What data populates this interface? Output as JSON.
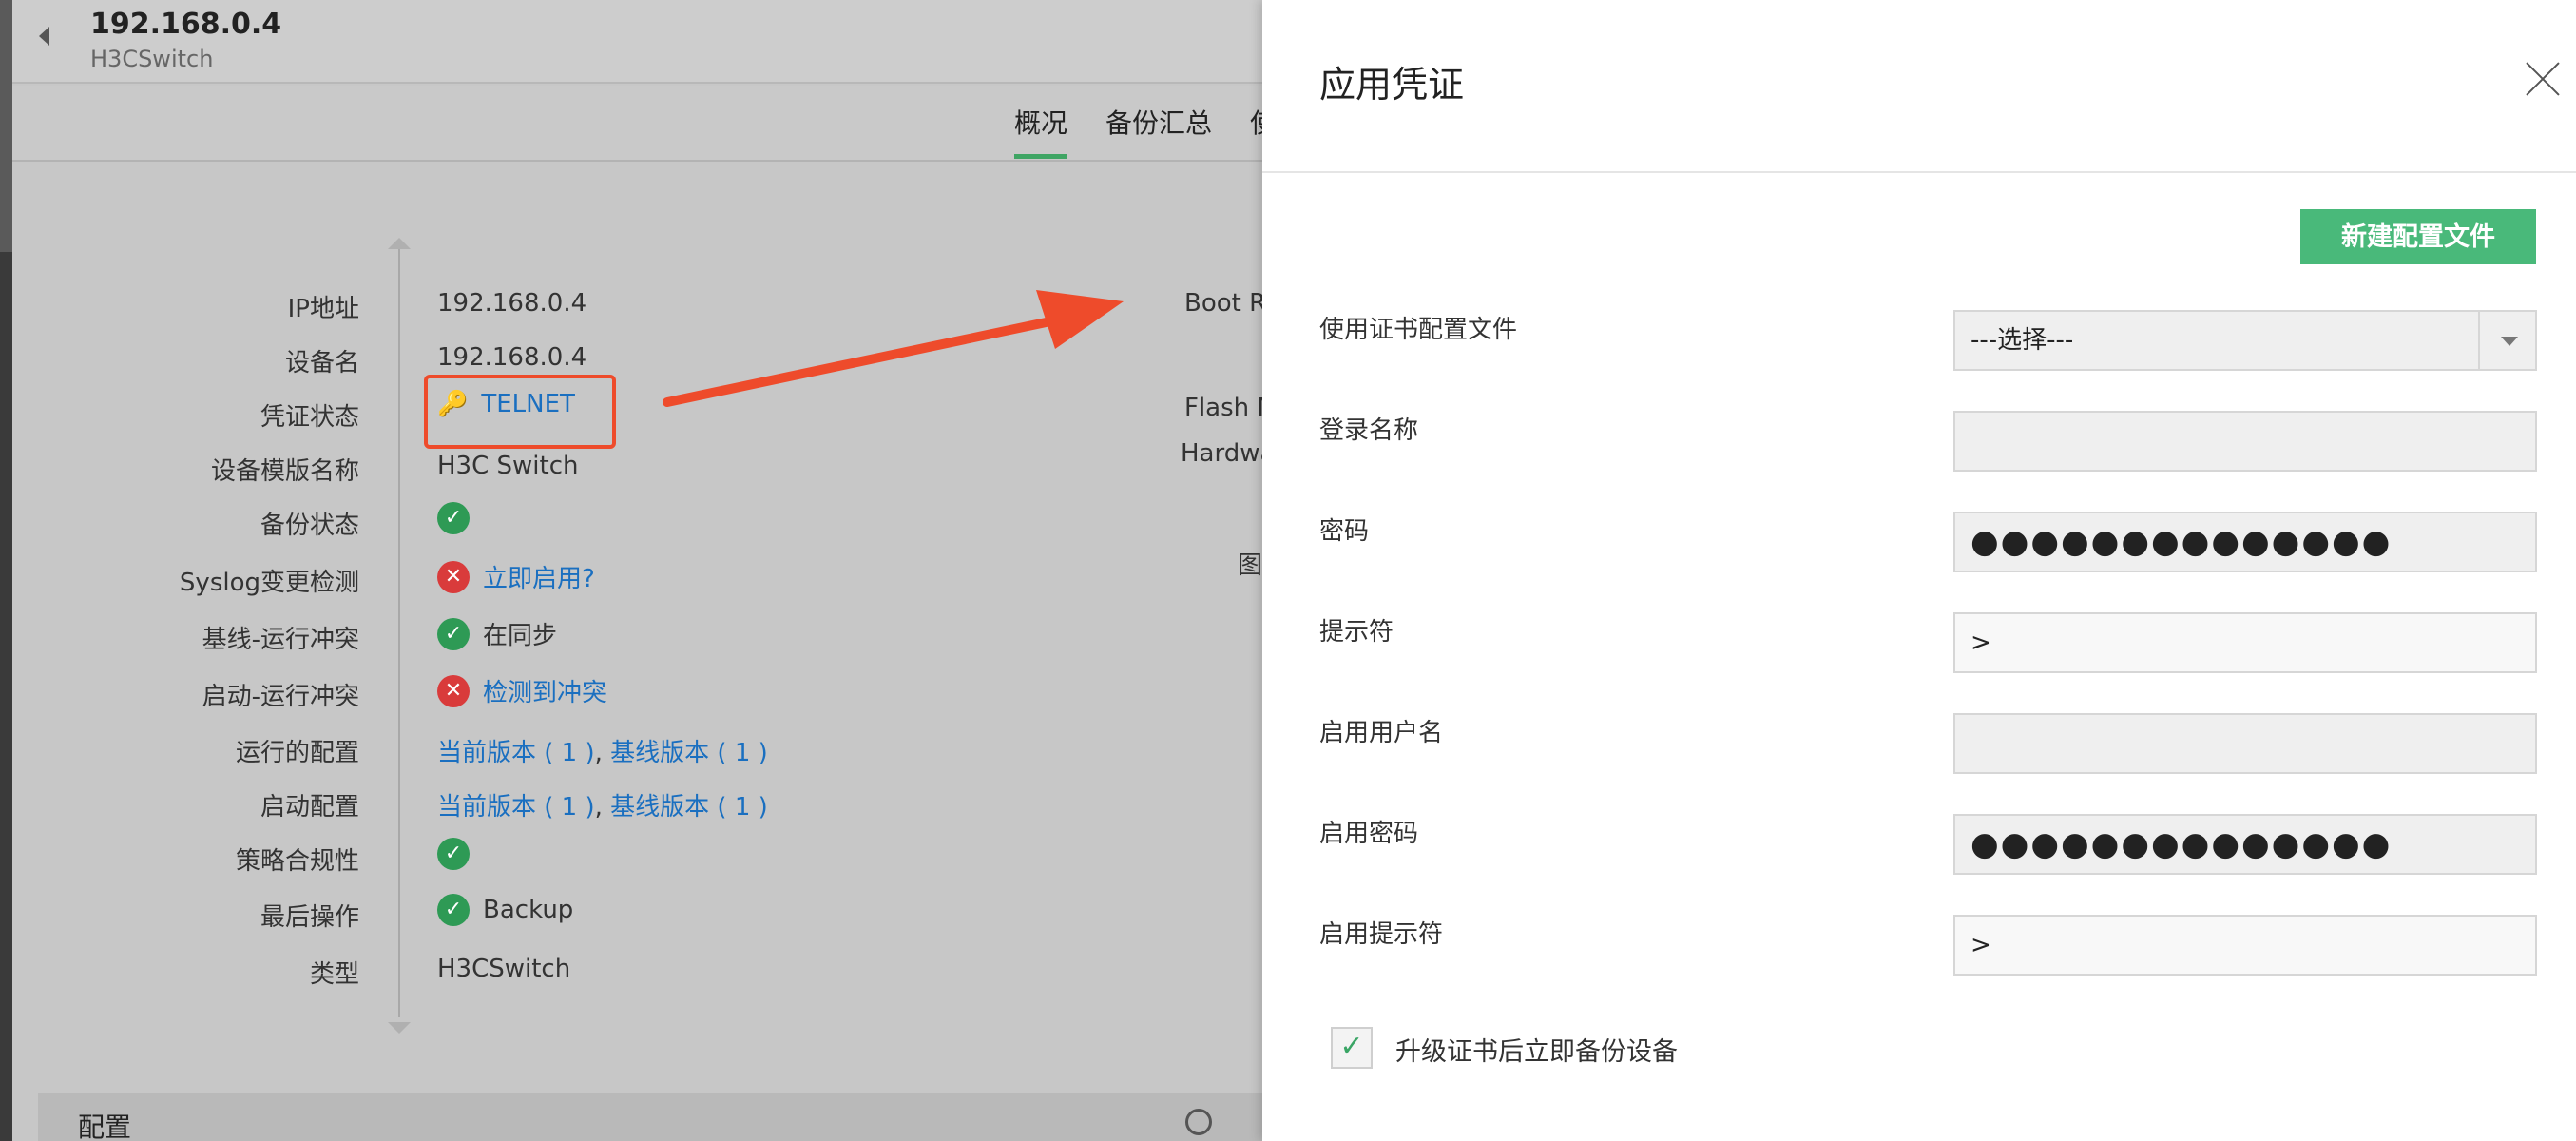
{
  "header": {
    "device_ip": "192.168.0.4",
    "device_type": "H3CSwitch"
  },
  "tabs": [
    "概况",
    "备份汇总",
    "使"
  ],
  "details": {
    "ip_label": "IP地址",
    "ip_value": "192.168.0.4",
    "name_label": "设备名",
    "name_value": "192.168.0.4",
    "cred_label": "凭证状态",
    "cred_value": "TELNET",
    "template_label": "设备模版名称",
    "template_value": "H3C Switch",
    "backup_label": "备份状态",
    "syslog_label": "Syslog变更检测",
    "syslog_value": "立即启用?",
    "baseline_label": "基线-运行冲突",
    "baseline_value": "在同步",
    "startup_conflict_label": "启动-运行冲突",
    "startup_conflict_value": "检测到冲突",
    "running_label": "运行的配置",
    "running_current": "当前版本 ( 1 )",
    "running_sep": ",",
    "running_baseline": "基线版本 ( 1 )",
    "startup_label": "启动配置",
    "startup_current": "当前版本 ( 1 )",
    "startup_sep": ",",
    "startup_baseline": "基线版本 ( 1 )",
    "policy_label": "策略合规性",
    "lastop_label": "最后操作",
    "lastop_value": "Backup",
    "type_label": "类型",
    "type_value": "H3CSwitch"
  },
  "right_labels": [
    "Boot R",
    "Flash M",
    "Hardwa",
    "图"
  ],
  "config_bar": {
    "title": "配置"
  },
  "drawer": {
    "title": "应用凭证",
    "new_button": "新建配置文件",
    "profile_label": "使用证书配置文件",
    "profile_value": "---选择---",
    "login_label": "登录名称",
    "login_value": "",
    "password_label": "密码",
    "password_value": "●●●●●●●●●●●●●●",
    "prompt_label": "提示符",
    "prompt_value": ">",
    "enable_user_label": "启用用户名",
    "enable_user_value": "",
    "enable_pwd_label": "启用密码",
    "enable_pwd_value": "●●●●●●●●●●●●●●",
    "enable_prompt_label": "启用提示符",
    "enable_prompt_value": ">",
    "backup_checkbox_label": "升级证书后立即备份设备",
    "backup_checked": true
  },
  "colors": {
    "accent": "#49b97a",
    "annotation": "#ee4b2b",
    "link": "#1a6fc0"
  }
}
